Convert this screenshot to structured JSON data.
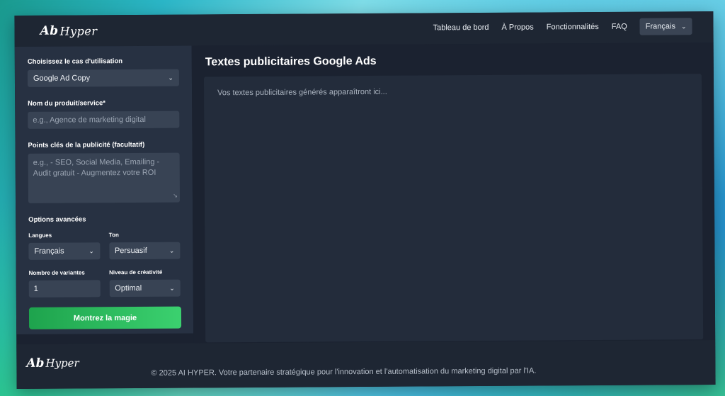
{
  "navbar": {
    "logo_mark": "Ab",
    "logo_text": "Hyper",
    "links": [
      "Tableau de bord",
      "À Propos",
      "Fonctionnalités",
      "FAQ"
    ],
    "language_selected": "Français"
  },
  "sidebar": {
    "use_case_label": "Choisissez le cas d'utilisation",
    "use_case_value": "Google Ad Copy",
    "product_label": "Nom du produit/service*",
    "product_placeholder": "e.g., Agence de marketing digital",
    "keypoints_label": "Points clés de la publicité (facultatif)",
    "keypoints_placeholder": "e.g., - SEO, Social Media, Emailing - Audit gratuit - Augmentez votre ROI",
    "advanced_label": "Options avancées",
    "languages_label": "Langues",
    "languages_value": "Français",
    "tone_label": "Ton",
    "tone_value": "Persuasif",
    "variants_label": "Nombre de variantes",
    "variants_value": "1",
    "creativity_label": "Niveau de créativité",
    "creativity_value": "Optimal",
    "submit_label": "Montrez la magie"
  },
  "main": {
    "title": "Textes publicitaires Google Ads",
    "output_placeholder": "Vos textes publicitaires générés apparaîtront ici..."
  },
  "footer": {
    "logo_mark": "Ab",
    "logo_text": "Hyper",
    "copyright": "© 2025 AI HYPER. Votre partenaire stratégique pour l'innovation et l'automatisation du marketing digital par l'IA."
  }
}
